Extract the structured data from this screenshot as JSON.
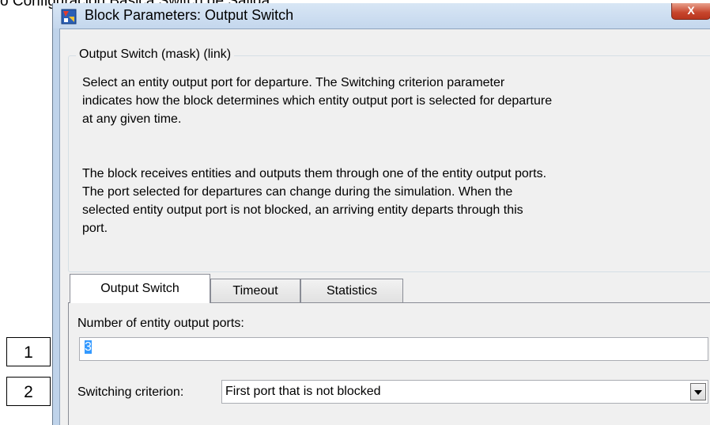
{
  "caption": "ó Configuración Básica  Switch de Salida",
  "window": {
    "title": "Block Parameters: Output Switch",
    "close_label": "X"
  },
  "group": {
    "legend": "Output Switch (mask) (link)",
    "paragraph_1": "Select an entity output port for departure. The Switching criterion parameter\nindicates how the block determines which entity output port is selected for departure\nat any given time.",
    "paragraph_2": "The block receives entities and outputs them through one of the entity output ports.\nThe port selected for departures can change during the simulation. When the\nselected entity output port is not blocked, an arriving entity departs through this\nport."
  },
  "tabs": [
    {
      "label": "Output Switch",
      "active": true
    },
    {
      "label": "Timeout",
      "active": false
    },
    {
      "label": "Statistics",
      "active": false
    }
  ],
  "fields": {
    "num_ports_label": "Number of entity output ports:",
    "num_ports_value": "3",
    "criterion_label": "Switching criterion:",
    "criterion_value": "First port that is not blocked"
  },
  "callouts": [
    "1",
    "2"
  ],
  "colors": {
    "titlebar": "#c4d7ed",
    "dialog_bg": "#f0f0f0",
    "close_button": "#c7452c",
    "selection": "#3399ff"
  }
}
